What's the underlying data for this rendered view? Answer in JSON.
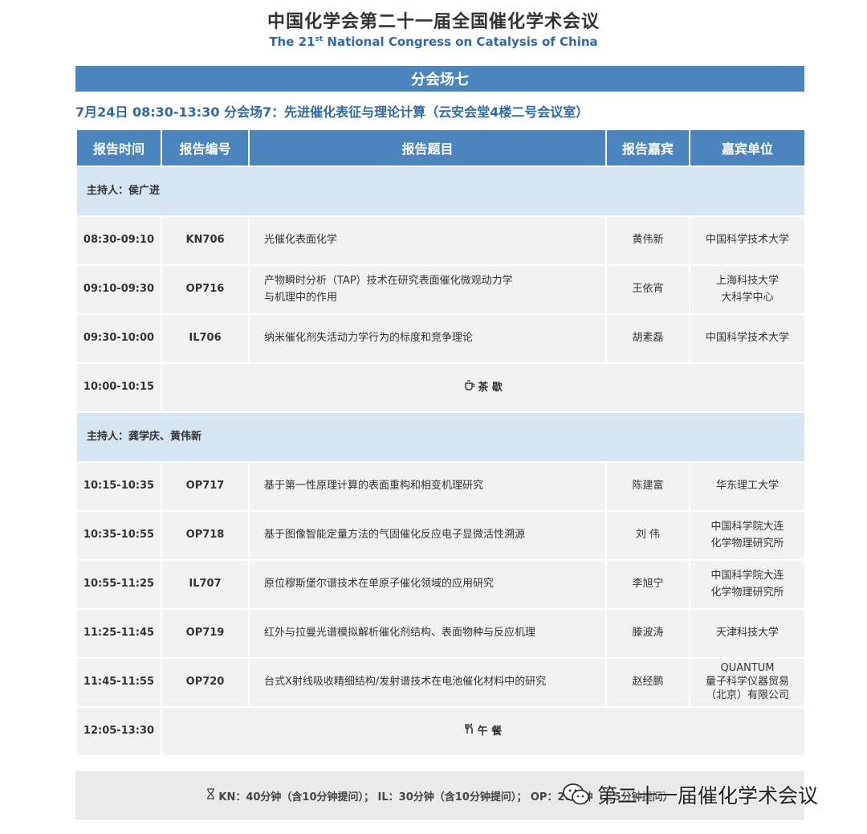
{
  "header": {
    "title_cn": "中国化学会第二十一届全国催化学术会议",
    "title_en_prefix": "The 21",
    "title_en_sup": "st",
    "title_en_suffix": " National Congress on Catalysis of China"
  },
  "venue": "分会场七",
  "session_line": "7月24日  08:30-13:30  分会场7：先进催化表征与理论计算（云安会堂4楼二号会议室）",
  "table": {
    "headers": [
      "报告时间",
      "报告编号",
      "报告题目",
      "报告嘉宾",
      "嘉宾单位"
    ],
    "chair1": "主持人：侯广进",
    "rows1": [
      {
        "time": "08:30-09:10",
        "code": "KN706",
        "topic": [
          "光催化表面化学"
        ],
        "speaker": "黄伟新",
        "affil": [
          "中国科学技术大学"
        ]
      },
      {
        "time": "09:10-09:30",
        "code": "OP716",
        "topic": [
          "产物瞬时分析（TAP）技术在研究表面催化微观动力学",
          "与机理中的作用"
        ],
        "speaker": "王依宵",
        "affil": [
          "上海科技大学",
          "大科学中心"
        ]
      },
      {
        "time": "09:30-10:00",
        "code": "IL706",
        "topic": [
          "纳米催化剂失活动力学行为的标度和竞争理论"
        ],
        "speaker": "胡素磊",
        "affil": [
          "中国科学技术大学"
        ]
      }
    ],
    "break1": {
      "time": "10:00-10:15",
      "icon": "tea-icon",
      "label": "茶  歇"
    },
    "chair2": "主持人：龚学庆、黄伟新",
    "rows2": [
      {
        "time": "10:15-10:35",
        "code": "OP717",
        "topic": [
          "基于第一性原理计算的表面重构和相变机理研究"
        ],
        "speaker": "陈建富",
        "affil": [
          "华东理工大学"
        ]
      },
      {
        "time": "10:35-10:55",
        "code": "OP718",
        "topic": [
          "基于图像智能定量方法的气固催化反应电子显微活性溯源"
        ],
        "speaker": "刘  伟",
        "affil": [
          "中国科学院大连",
          "化学物理研究所"
        ]
      },
      {
        "time": "10:55-11:25",
        "code": "IL707",
        "topic": [
          "原位穆斯堡尔谱技术在单原子催化领域的应用研究"
        ],
        "speaker": "李旭宁",
        "affil": [
          "中国科学院大连",
          "化学物理研究所"
        ]
      },
      {
        "time": "11:25-11:45",
        "code": "OP719",
        "topic": [
          "红外与拉曼光谱模拟解析催化剂结构、表面物种与反应机理"
        ],
        "speaker": "滕波涛",
        "affil": [
          "天津科技大学"
        ]
      },
      {
        "time": "11:45-11:55",
        "code": "OP720",
        "topic": [
          "台式X射线吸收精细结构/发射谱技术在电池催化材料中的研究"
        ],
        "speaker": "赵经鹏",
        "affil": [
          "QUANTUM",
          "量子科学仪器贸易",
          "（北京）有限公司"
        ]
      }
    ],
    "break2": {
      "time": "12:05-13:30",
      "icon": "utensils-icon",
      "label": "午  餐"
    }
  },
  "footer": {
    "icon": "hourglass-icon",
    "text": "KN：40分钟（含10分钟提问）；  IL：30分钟（含10分钟提问）；  OP：20分钟（含5分钟提问）"
  },
  "watermark": {
    "icon": "wechat-icon",
    "text": "第二十一届催化学术会议"
  },
  "colors": {
    "accent": "#4a86bd",
    "title_blue": "#2f6aa6",
    "chair_bg": "#d5e5f1",
    "cell_bg": "#f2f2f2"
  }
}
